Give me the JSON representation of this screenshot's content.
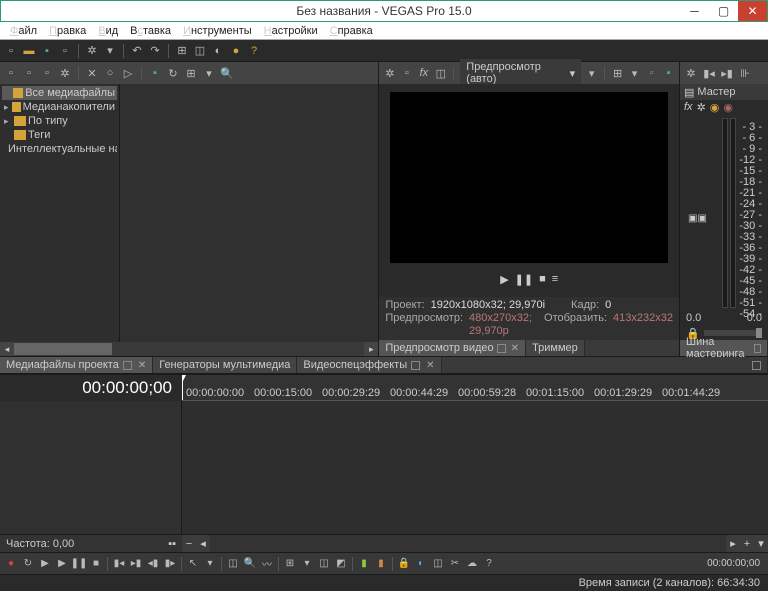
{
  "title": "Без названия - VEGAS Pro 15.0",
  "menu": [
    "Файл",
    "Правка",
    "Вид",
    "Вставка",
    "Инструменты",
    "Настройки",
    "Справка"
  ],
  "tree": {
    "items": [
      {
        "label": "Все медиафайлы",
        "sel": true,
        "exp": ""
      },
      {
        "label": "Медианакопители",
        "sel": false,
        "exp": "▸"
      },
      {
        "label": "По типу",
        "sel": false,
        "exp": "▸"
      },
      {
        "label": "Теги",
        "sel": false,
        "exp": ""
      },
      {
        "label": "Интеллектуальные нак",
        "sel": false,
        "exp": ""
      }
    ]
  },
  "preview": {
    "dropdown": "Предпросмотр (авто)",
    "info": {
      "project_lbl": "Проект:",
      "project_val": "1920x1080x32; 29,970i",
      "frame_lbl": "Кадр:",
      "frame_val": "0",
      "preview_lbl": "Предпросмотр:",
      "preview_val": "480x270x32; 29,970p",
      "display_lbl": "Отобразить:",
      "display_val": "413x232x32"
    },
    "tabs": [
      "Предпросмотр видео",
      "Триммер"
    ]
  },
  "master": {
    "label": "Мастер",
    "scale": [
      "- 3 -",
      "- 6 -",
      "- 9 -",
      "-12 -",
      "-15 -",
      "-18 -",
      "-21 -",
      "-24 -",
      "-27 -",
      "-30 -",
      "-33 -",
      "-36 -",
      "-39 -",
      "-42 -",
      "-45 -",
      "-48 -",
      "-51 -",
      "-54 -"
    ],
    "bottom_l": "0.0",
    "bottom_r": "0.0",
    "tab": "Шина мастеринга"
  },
  "tabs": [
    "Медиафайлы проекта",
    "Генераторы мультимедиа",
    "Видеоспецэффекты"
  ],
  "timeline": {
    "time": "00:00:00;00",
    "marks": [
      "00:00:00:00",
      "00:00:15:00",
      "00:00:29:29",
      "00:00:44:29",
      "00:00:59:28",
      "00:01:15:00",
      "00:01:29:29",
      "00:01:44:29"
    ],
    "freq": "Частота: 0,00",
    "tc": "00:00:00;00"
  },
  "status": "Время записи (2 каналов): 66:34:30"
}
